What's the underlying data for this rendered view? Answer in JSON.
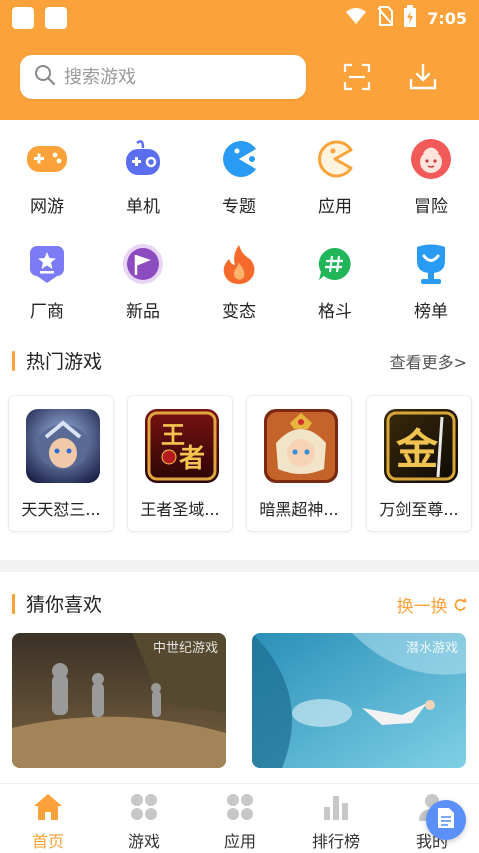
{
  "status_bar": {
    "time": "7:05"
  },
  "search": {
    "placeholder": "搜索游戏"
  },
  "header": {
    "scan_icon": "scan-icon",
    "download_icon": "download-icon"
  },
  "categories": [
    {
      "label": "网游",
      "icon": "gamepad-icon",
      "color": "#fba23a"
    },
    {
      "label": "单机",
      "icon": "controller-icon",
      "color": "#5b6ef0"
    },
    {
      "label": "专题",
      "icon": "pacman-icon",
      "color": "#2a9bf5"
    },
    {
      "label": "应用",
      "icon": "pacman-outline-icon",
      "color": "#fba23a"
    },
    {
      "label": "冒险",
      "icon": "face-icon",
      "color": "#f25a5a"
    },
    {
      "label": "厂商",
      "icon": "star-badge-icon",
      "color": "#7b7cf5"
    },
    {
      "label": "新品",
      "icon": "flag-icon",
      "color": "#8c4bbf"
    },
    {
      "label": "变态",
      "icon": "flame-icon",
      "color": "#f56a2a"
    },
    {
      "label": "格斗",
      "icon": "hash-chat-icon",
      "color": "#22b65a"
    },
    {
      "label": "榜单",
      "icon": "podium-icon",
      "color": "#2a9bf5"
    }
  ],
  "hot_games": {
    "title": "热门游戏",
    "more": "查看更多>",
    "items": [
      {
        "name": "天天怼三..."
      },
      {
        "name": "王者圣域..."
      },
      {
        "name": "暗黑超神..."
      },
      {
        "name": "万剑至尊..."
      }
    ]
  },
  "guess": {
    "title": "猜你喜欢",
    "refresh": "换一换",
    "items": [
      {
        "tag": "中世纪游戏"
      },
      {
        "tag": "潜水游戏"
      }
    ]
  },
  "bottom_nav": [
    {
      "label": "首页",
      "icon": "home-icon",
      "active": true
    },
    {
      "label": "游戏",
      "icon": "games-grid-icon",
      "active": false
    },
    {
      "label": "应用",
      "icon": "apps-grid-icon",
      "active": false
    },
    {
      "label": "排行榜",
      "icon": "ranking-icon",
      "active": false
    },
    {
      "label": "我的",
      "icon": "profile-icon",
      "active": false
    }
  ],
  "colors": {
    "accent": "#fba23a",
    "inactive": "#c7c7c7"
  }
}
